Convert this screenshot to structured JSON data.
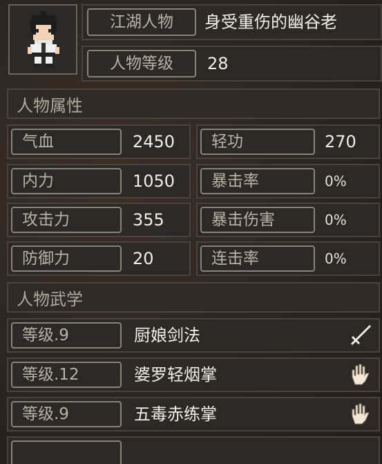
{
  "character": {
    "name_label": "江湖人物",
    "name": "身受重伤的幽谷老",
    "level_label": "人物等级",
    "level": "28"
  },
  "attributes": {
    "title": "人物属性",
    "hp_label": "气血",
    "hp": "2450",
    "qinggong_label": "轻功",
    "qinggong": "270",
    "neili_label": "内力",
    "neili": "1050",
    "crit_rate_label": "暴击率",
    "crit_rate": "0%",
    "attack_label": "攻击力",
    "attack": "355",
    "crit_dmg_label": "暴击伤害",
    "crit_dmg": "0%",
    "defense_label": "防御力",
    "defense": "20",
    "combo_label": "连击率",
    "combo": "0%"
  },
  "martial": {
    "title": "人物武学",
    "skills": [
      {
        "level": "等级.9",
        "name": "厨娘剑法",
        "icon": "sword-icon"
      },
      {
        "level": "等级.12",
        "name": "婆罗轻烟掌",
        "icon": "palm-icon"
      },
      {
        "level": "等级.9",
        "name": "五毒赤练掌",
        "icon": "palm-icon"
      }
    ]
  }
}
